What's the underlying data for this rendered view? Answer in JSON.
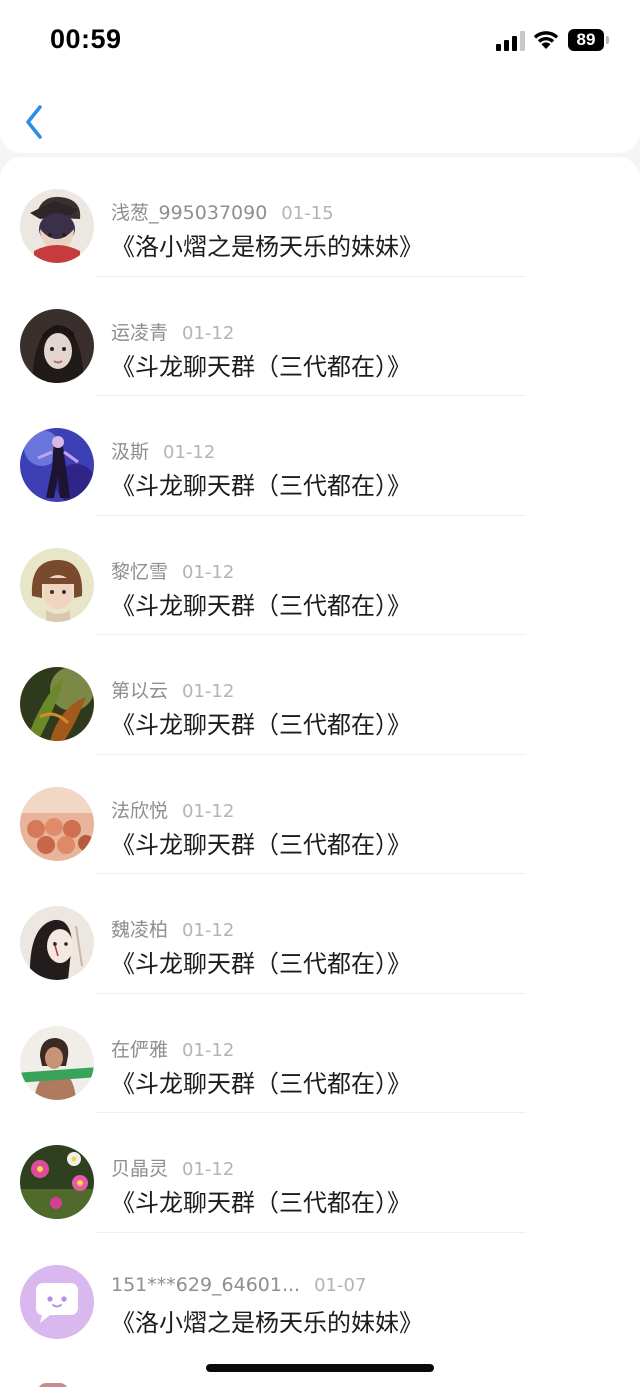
{
  "status_bar": {
    "time": "00:59",
    "battery": "89"
  },
  "header": {
    "back_icon": "chevron-left-icon",
    "accent_color": "#2b8fe6"
  },
  "list": [
    {
      "name": "浅葱_995037090",
      "date": "01-15",
      "title": "《洛小熠之是杨天乐的妹妹》",
      "avatar": "anime-character"
    },
    {
      "name": "运凌青",
      "date": "01-12",
      "title": "《斗龙聊天群（三代都在）》",
      "avatar": "portrait-girl"
    },
    {
      "name": "汲斯",
      "date": "01-12",
      "title": "《斗龙聊天群（三代都在）》",
      "avatar": "fantasy-figure"
    },
    {
      "name": "黎忆雪",
      "date": "01-12",
      "title": "《斗龙聊天群（三代都在）》",
      "avatar": "bob-hair-girl"
    },
    {
      "name": "第以云",
      "date": "01-12",
      "title": "《斗龙聊天群（三代都在）》",
      "avatar": "leaves-nature"
    },
    {
      "name": "法欣悦",
      "date": "01-12",
      "title": "《斗龙聊天群（三代都在）》",
      "avatar": "toy-figures"
    },
    {
      "name": "魏凌柏",
      "date": "01-12",
      "title": "《斗龙聊天群（三代都在）》",
      "avatar": "painted-face"
    },
    {
      "name": "在俨雅",
      "date": "01-12",
      "title": "《斗龙聊天群（三代都在）》",
      "avatar": "woman-green-banner"
    },
    {
      "name": "贝晶灵",
      "date": "01-12",
      "title": "《斗龙聊天群（三代都在）》",
      "avatar": "pink-flowers"
    },
    {
      "name": "151***629_64601...",
      "date": "01-07",
      "title": "《洛小熠之是杨天乐的妹妹》",
      "avatar": "chat-bubble-default"
    }
  ]
}
